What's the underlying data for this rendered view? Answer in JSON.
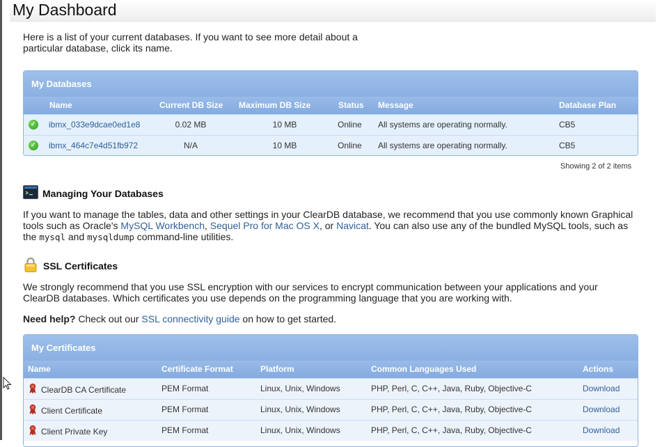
{
  "page": {
    "title": "My Dashboard",
    "intro": "Here is a list of your current databases. If you want to see more detail about a particular database, click its name."
  },
  "databases": {
    "panel_title": "My Databases",
    "columns": [
      "Name",
      "Current DB Size",
      "Maximum DB Size",
      "Status",
      "Message",
      "Database Plan"
    ],
    "rows": [
      {
        "name": "ibmx_033e9dcae0ed1e8",
        "current_size": "0.02 MB",
        "max_size": "10 MB",
        "status": "Online",
        "message": "All systems are operating normally.",
        "plan": "CB5",
        "status_icon": "check-circle-icon"
      },
      {
        "name": "ibmx_464c7e4d51fb972",
        "current_size": "N/A",
        "max_size": "10 MB",
        "status": "Online",
        "message": "All systems are operating normally.",
        "plan": "CB5",
        "status_icon": "check-circle-icon"
      }
    ],
    "showing": "Showing 2 of 2 items"
  },
  "managing": {
    "icon": "terminal-icon",
    "title": "Managing Your Databases",
    "text_1": "If you want to manage the tables, data and other settings in your ClearDB database, we recommend that you use commonly known Graphical tools such as Oracle's ",
    "link_workbench": "MySQL Workbench",
    "sep_1": ", ",
    "link_sequel": "Sequel Pro for Mac OS X",
    "sep_2": ", or ",
    "link_navicat": "Navicat",
    "text_2": ". You can also use any of the bundled MySQL tools, such as the ",
    "code_mysql": "mysql",
    "text_3": " and ",
    "code_mysqldump": "mysqldump",
    "text_4": " command-line utilities."
  },
  "ssl": {
    "icon": "lock-icon",
    "title": "SSL Certificates",
    "text": "We strongly recommend that you use SSL encryption with our services to encrypt communication between your applications and your ClearDB databases. Which certificates you use depends on the programming language that you are working with.",
    "help_bold": "Need help?",
    "help_text_1": " Check out our ",
    "help_link": "SSL connectivity guide",
    "help_text_2": " on how to get started."
  },
  "certificates": {
    "panel_title": "My Certificates",
    "columns": [
      "Name",
      "Certificate Format",
      "Platform",
      "Common Languages Used",
      "Actions"
    ],
    "rows": [
      {
        "name": "ClearDB CA Certificate",
        "format": "PEM Format",
        "platform": "Linux, Unix, Windows",
        "languages": "PHP, Perl, C, C++, Java, Ruby, Objective-C",
        "action": "Download"
      },
      {
        "name": "Client Certificate",
        "format": "PEM Format",
        "platform": "Linux, Unix, Windows",
        "languages": "PHP, Perl, C, C++, Java, Ruby, Objective-C",
        "action": "Download"
      },
      {
        "name": "Client Private Key",
        "format": "PEM Format",
        "platform": "Linux, Unix, Windows",
        "languages": "PHP, Perl, C, C++, Java, Ruby, Objective-C",
        "action": "Download"
      }
    ]
  },
  "colors": {
    "panel_header": "#8ab0e2",
    "link": "#2f5f9a",
    "row_background": "#e4f0fb",
    "ok_green": "#2a9a1a",
    "ribbon_red": "#c0392b"
  }
}
